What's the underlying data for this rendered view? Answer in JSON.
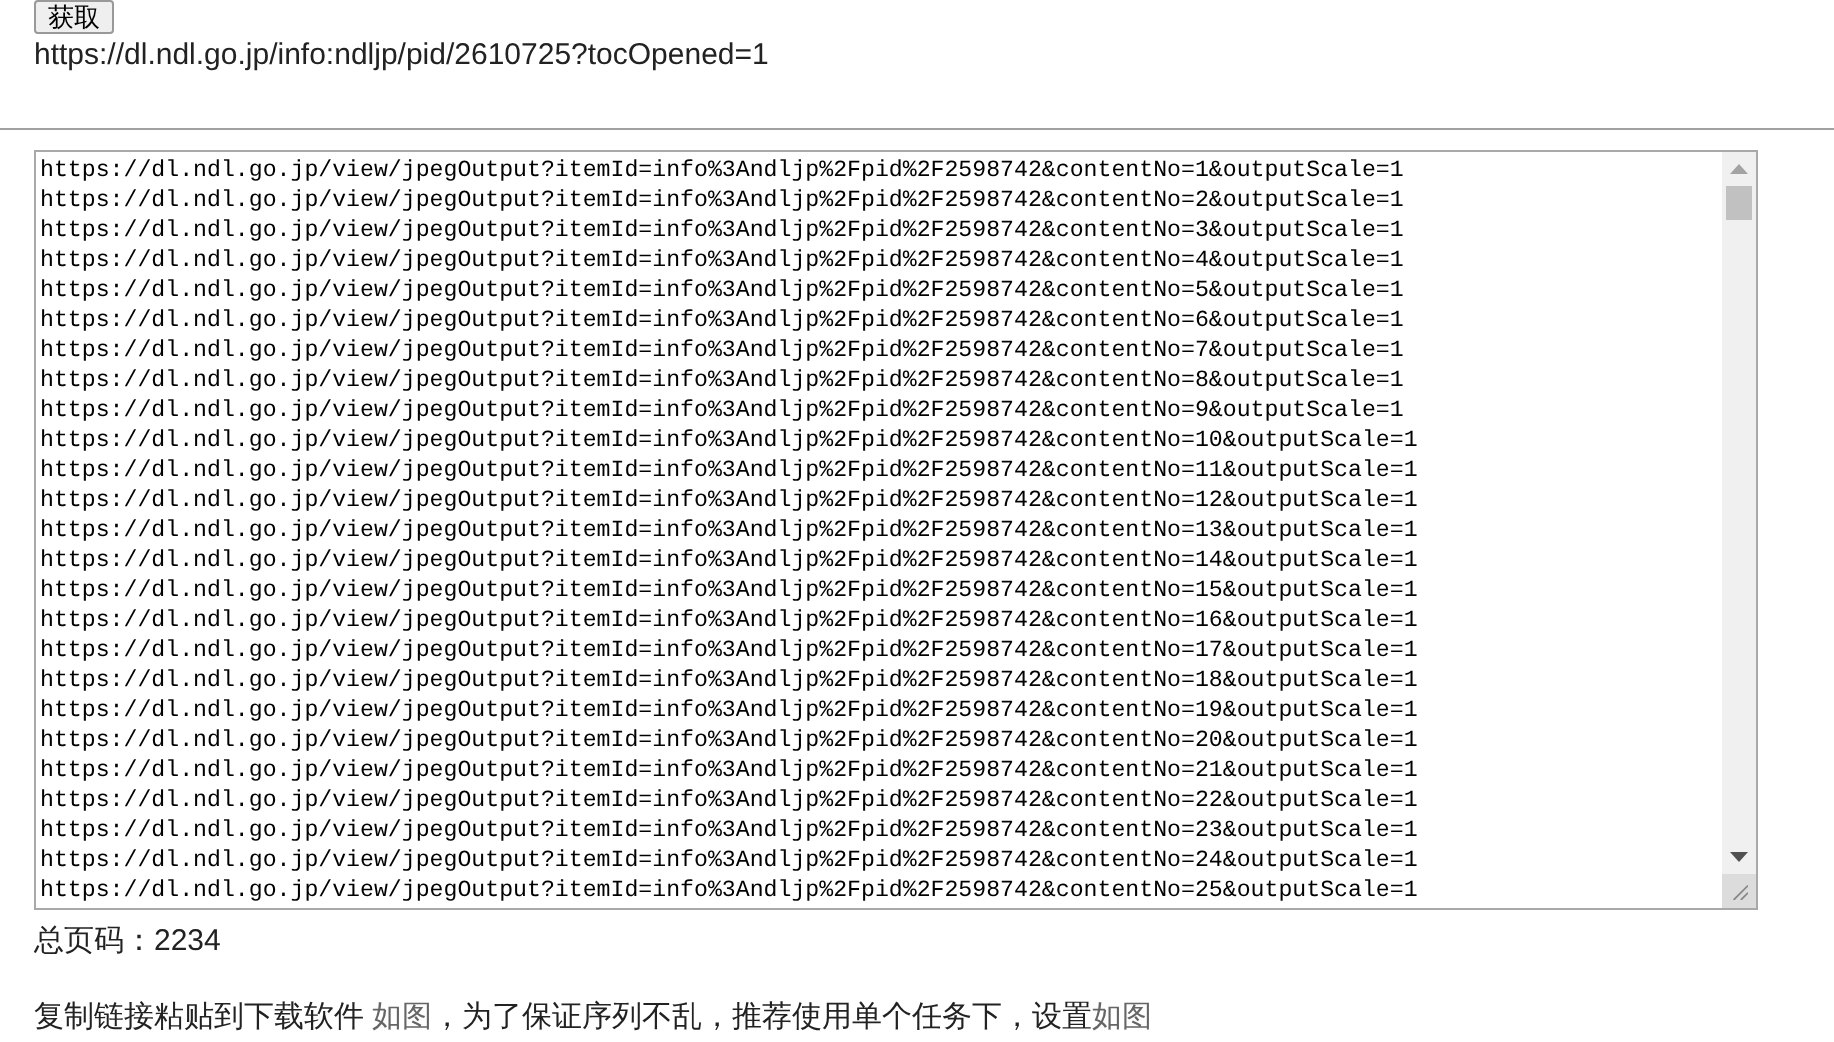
{
  "fetch_button": "获取",
  "source_url": "https://dl.ndl.go.jp/info:ndljp/pid/2610725?tocOpened=1",
  "output_lines": [
    "https://dl.ndl.go.jp/view/jpegOutput?itemId=info%3Andljp%2Fpid%2F2598742&contentNo=1&outputScale=1",
    "https://dl.ndl.go.jp/view/jpegOutput?itemId=info%3Andljp%2Fpid%2F2598742&contentNo=2&outputScale=1",
    "https://dl.ndl.go.jp/view/jpegOutput?itemId=info%3Andljp%2Fpid%2F2598742&contentNo=3&outputScale=1",
    "https://dl.ndl.go.jp/view/jpegOutput?itemId=info%3Andljp%2Fpid%2F2598742&contentNo=4&outputScale=1",
    "https://dl.ndl.go.jp/view/jpegOutput?itemId=info%3Andljp%2Fpid%2F2598742&contentNo=5&outputScale=1",
    "https://dl.ndl.go.jp/view/jpegOutput?itemId=info%3Andljp%2Fpid%2F2598742&contentNo=6&outputScale=1",
    "https://dl.ndl.go.jp/view/jpegOutput?itemId=info%3Andljp%2Fpid%2F2598742&contentNo=7&outputScale=1",
    "https://dl.ndl.go.jp/view/jpegOutput?itemId=info%3Andljp%2Fpid%2F2598742&contentNo=8&outputScale=1",
    "https://dl.ndl.go.jp/view/jpegOutput?itemId=info%3Andljp%2Fpid%2F2598742&contentNo=9&outputScale=1",
    "https://dl.ndl.go.jp/view/jpegOutput?itemId=info%3Andljp%2Fpid%2F2598742&contentNo=10&outputScale=1",
    "https://dl.ndl.go.jp/view/jpegOutput?itemId=info%3Andljp%2Fpid%2F2598742&contentNo=11&outputScale=1",
    "https://dl.ndl.go.jp/view/jpegOutput?itemId=info%3Andljp%2Fpid%2F2598742&contentNo=12&outputScale=1",
    "https://dl.ndl.go.jp/view/jpegOutput?itemId=info%3Andljp%2Fpid%2F2598742&contentNo=13&outputScale=1",
    "https://dl.ndl.go.jp/view/jpegOutput?itemId=info%3Andljp%2Fpid%2F2598742&contentNo=14&outputScale=1",
    "https://dl.ndl.go.jp/view/jpegOutput?itemId=info%3Andljp%2Fpid%2F2598742&contentNo=15&outputScale=1",
    "https://dl.ndl.go.jp/view/jpegOutput?itemId=info%3Andljp%2Fpid%2F2598742&contentNo=16&outputScale=1",
    "https://dl.ndl.go.jp/view/jpegOutput?itemId=info%3Andljp%2Fpid%2F2598742&contentNo=17&outputScale=1",
    "https://dl.ndl.go.jp/view/jpegOutput?itemId=info%3Andljp%2Fpid%2F2598742&contentNo=18&outputScale=1",
    "https://dl.ndl.go.jp/view/jpegOutput?itemId=info%3Andljp%2Fpid%2F2598742&contentNo=19&outputScale=1",
    "https://dl.ndl.go.jp/view/jpegOutput?itemId=info%3Andljp%2Fpid%2F2598742&contentNo=20&outputScale=1",
    "https://dl.ndl.go.jp/view/jpegOutput?itemId=info%3Andljp%2Fpid%2F2598742&contentNo=21&outputScale=1",
    "https://dl.ndl.go.jp/view/jpegOutput?itemId=info%3Andljp%2Fpid%2F2598742&contentNo=22&outputScale=1",
    "https://dl.ndl.go.jp/view/jpegOutput?itemId=info%3Andljp%2Fpid%2F2598742&contentNo=23&outputScale=1",
    "https://dl.ndl.go.jp/view/jpegOutput?itemId=info%3Andljp%2Fpid%2F2598742&contentNo=24&outputScale=1",
    "https://dl.ndl.go.jp/view/jpegOutput?itemId=info%3Andljp%2Fpid%2F2598742&contentNo=25&outputScale=1"
  ],
  "total_pages": "总页码：2234",
  "instructions": [
    {
      "kind": "text",
      "text": "复制链接粘贴到下载软件 "
    },
    {
      "kind": "link",
      "text": "如图"
    },
    {
      "kind": "text",
      "text": "，为了保证序列不乱，推荐使用单个任务下，设置"
    },
    {
      "kind": "link",
      "text": "如图"
    }
  ]
}
